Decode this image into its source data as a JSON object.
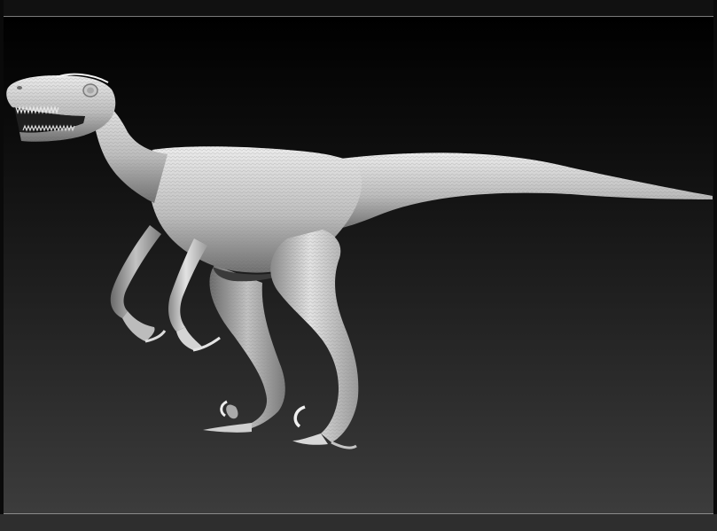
{
  "viewport": {
    "subject": "raptor-sculpt",
    "colors": {
      "background_top": "#000000",
      "background_bottom": "#3c3c3c",
      "model_light": "#e6e6e6",
      "model_mid": "#b4b4b4",
      "model_dark": "#5a5a5a"
    }
  }
}
